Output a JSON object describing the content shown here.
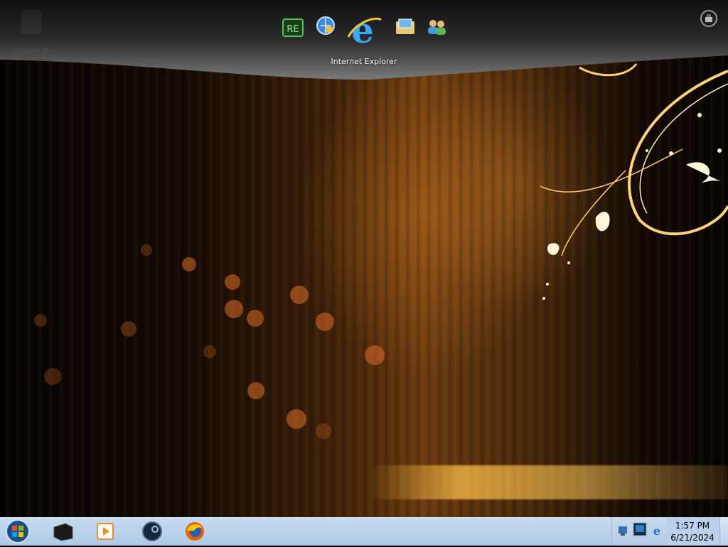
{
  "desktop": {
    "recycle_bin_label": "Recycle Bin"
  },
  "dock": {
    "items": [
      {
        "name": "dock-item-app-1",
        "icon": "green-cube-app-icon"
      },
      {
        "name": "dock-item-app-2",
        "icon": "globe-pin-icon"
      },
      {
        "name": "dock-item-internet-explorer",
        "icon": "internet-explorer-icon"
      },
      {
        "name": "dock-item-app-4",
        "icon": "folder-window-icon"
      },
      {
        "name": "dock-item-app-5",
        "icon": "users-icon"
      }
    ],
    "hover_label": "Internet Explorer"
  },
  "taskbar": {
    "start": "start-orb-icon",
    "pinned": [
      {
        "name": "taskbar-item-1",
        "icon": "black-box-icon"
      },
      {
        "name": "taskbar-item-2",
        "icon": "media-player-icon"
      },
      {
        "name": "taskbar-item-3",
        "icon": "steam-icon"
      },
      {
        "name": "taskbar-item-4",
        "icon": "firefox-icon"
      }
    ],
    "tray": [
      "network-icon",
      "monitor-icon",
      "ie-tray-icon"
    ],
    "clock": {
      "time": "1:57 PM",
      "date": "6/21/2024"
    }
  },
  "colors": {
    "taskbar": "#b9d1ea",
    "wallpaper_accent": "#e8a040"
  }
}
